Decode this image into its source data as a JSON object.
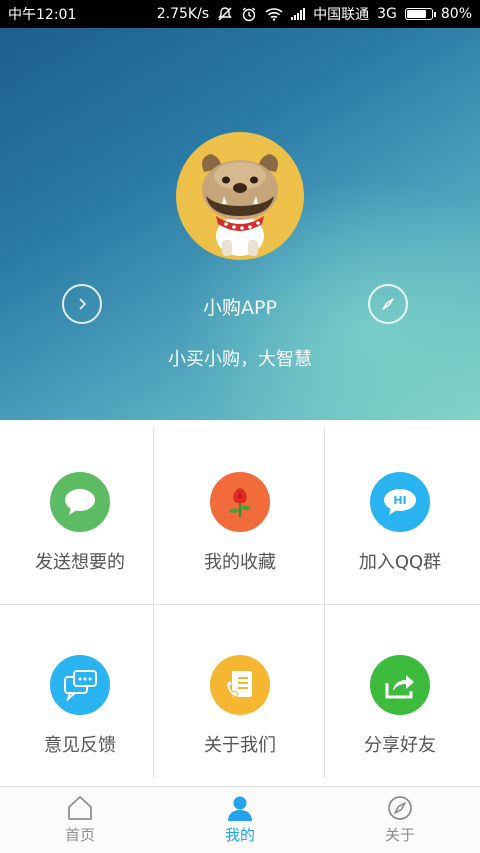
{
  "status_bar": {
    "time": "中午12:01",
    "net_speed": "2.75K/s",
    "carrier": "中国联通",
    "network": "3G",
    "battery": "80%",
    "battery_level": 0.8
  },
  "hero": {
    "app_name": "小购APP",
    "slogan": "小买小购，大智慧",
    "gradient_start": "#1d5f8f",
    "gradient_end": "#7fd2c6",
    "avatar_bg": "#edc04a"
  },
  "grid": {
    "items": [
      {
        "label": "发送想要的",
        "icon": "chat-bubble-icon",
        "color": "#5dbb63"
      },
      {
        "label": "我的收藏",
        "icon": "rose-icon",
        "color": "#f26b3a"
      },
      {
        "label": "加入QQ群",
        "icon": "hi-bubble-icon",
        "color": "#29b3f0"
      },
      {
        "label": "意见反馈",
        "icon": "feedback-icon",
        "color": "#29b3f0"
      },
      {
        "label": "关于我们",
        "icon": "contact-card-icon",
        "color": "#f5b731"
      },
      {
        "label": "分享好友",
        "icon": "share-icon",
        "color": "#3cbb3c"
      }
    ]
  },
  "tab_bar": {
    "tabs": [
      {
        "label": "首页",
        "icon": "home-icon"
      },
      {
        "label": "我的",
        "icon": "user-icon"
      },
      {
        "label": "关于",
        "icon": "compass-icon"
      }
    ],
    "active": "我的",
    "active_color": "#23a3ee",
    "inactive_color": "#8e8e8e"
  }
}
